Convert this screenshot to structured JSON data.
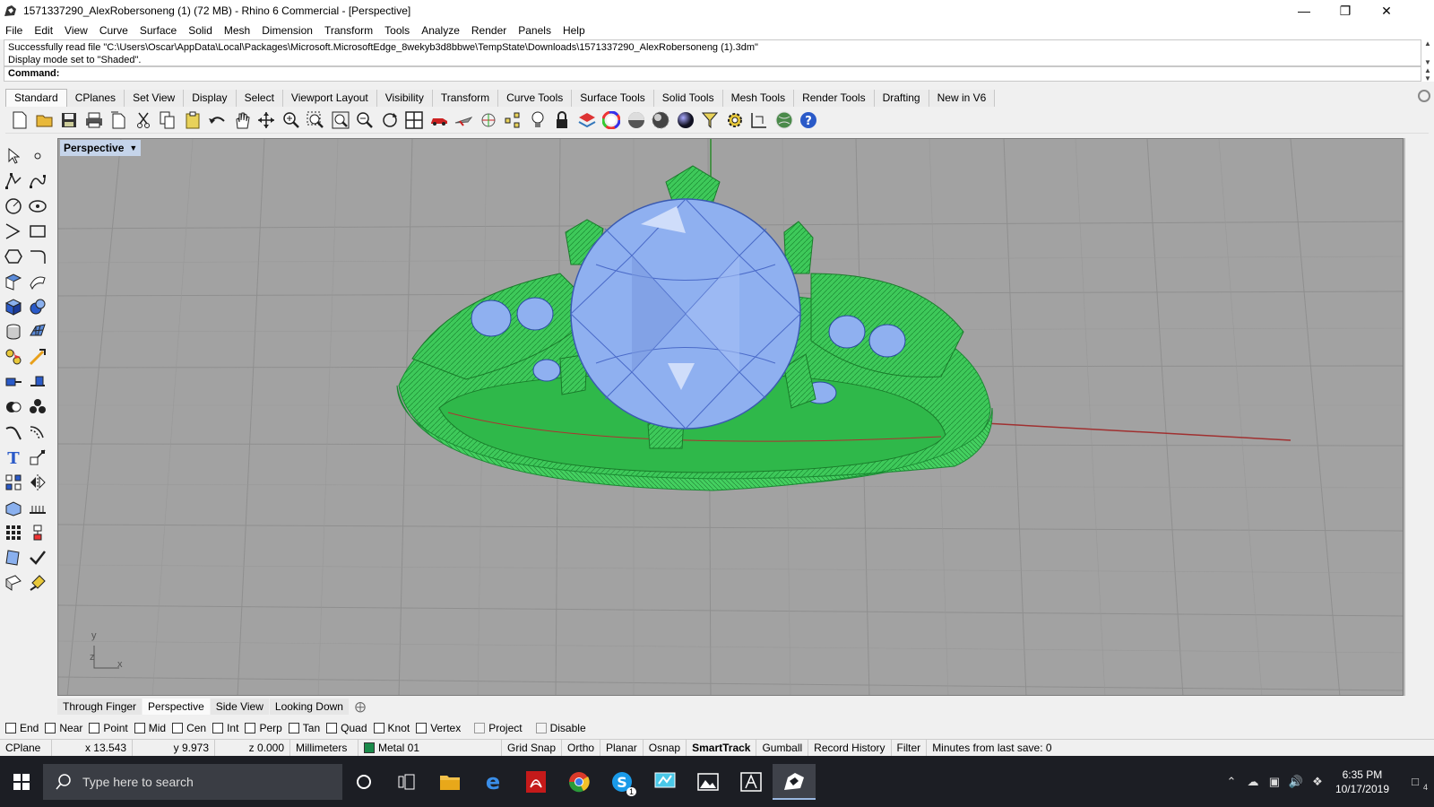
{
  "window": {
    "title": "1571337290_AlexRobersoneng (1) (72 MB) - Rhino 6 Commercial - [Perspective]",
    "minimize_icon": "minimize-icon",
    "maximize_icon": "restore-icon",
    "close_icon": "close-icon"
  },
  "menu": [
    "File",
    "Edit",
    "View",
    "Curve",
    "Surface",
    "Solid",
    "Mesh",
    "Dimension",
    "Transform",
    "Tools",
    "Analyze",
    "Render",
    "Panels",
    "Help"
  ],
  "command_history": {
    "line1": "Successfully read file \"C:\\Users\\Oscar\\AppData\\Local\\Packages\\Microsoft.MicrosoftEdge_8wekyb3d8bbwe\\TempState\\Downloads\\1571337290_AlexRobersoneng (1).3dm\"",
    "line2": "Display mode set to \"Shaded\"."
  },
  "command_prompt": "Command:",
  "toolbar_tabs": [
    "Standard",
    "CPlanes",
    "Set View",
    "Display",
    "Select",
    "Viewport Layout",
    "Visibility",
    "Transform",
    "Curve Tools",
    "Surface Tools",
    "Solid Tools",
    "Mesh Tools",
    "Render Tools",
    "Drafting",
    "New in V6"
  ],
  "active_tab": "Standard",
  "standard_tools": [
    "new-icon",
    "open-icon",
    "save-icon",
    "print-icon",
    "import-icon",
    "cut-icon",
    "copy-icon",
    "paste-icon",
    "undo-icon",
    "pan-icon",
    "rotate-view-icon",
    "zoom-dynamic-icon",
    "zoom-window-icon",
    "zoom-extents-icon",
    "zoom-selected-icon",
    "rotate-icon",
    "viewport-layout-icon",
    "car-icon",
    "flying-icon",
    "cplane-icon",
    "points-icon",
    "light-icon",
    "lock-icon",
    "layer-icon",
    "color-wheel-icon",
    "material-icon",
    "render-sphere-icon",
    "rendered-sphere-icon",
    "filter-icon",
    "settings-gear-icon",
    "dimension-icon",
    "plugin-globe-icon",
    "help-icon"
  ],
  "viewport": {
    "label": "Perspective",
    "axis_x": "x",
    "axis_y": "y",
    "axis_z": "z",
    "colors": {
      "background": "#a2a2a2",
      "grid": "#8e8e8e",
      "metal": "#3ec95a",
      "gem": "#8fb0f0",
      "x_axis": "#a03030",
      "y_axis": "#2a8a2a"
    }
  },
  "viewport_tabs": [
    "Through Finger",
    "Perspective",
    "Side View",
    "Looking Down"
  ],
  "active_viewport_tab": "Perspective",
  "osnaps": [
    {
      "label": "End",
      "checked": false
    },
    {
      "label": "Near",
      "checked": false
    },
    {
      "label": "Point",
      "checked": false
    },
    {
      "label": "Mid",
      "checked": false
    },
    {
      "label": "Cen",
      "checked": false
    },
    {
      "label": "Int",
      "checked": false
    },
    {
      "label": "Perp",
      "checked": false
    },
    {
      "label": "Tan",
      "checked": false
    },
    {
      "label": "Quad",
      "checked": false
    },
    {
      "label": "Knot",
      "checked": false
    },
    {
      "label": "Vertex",
      "checked": false
    },
    {
      "label": "Project",
      "checked": false
    },
    {
      "label": "Disable",
      "checked": false
    }
  ],
  "status": {
    "cplane": "CPlane",
    "x": "x 13.543",
    "y": "y 9.973",
    "z": "z 0.000",
    "units": "Millimeters",
    "layer": "Metal 01",
    "grid_snap": "Grid Snap",
    "ortho": "Ortho",
    "planar": "Planar",
    "osnap": "Osnap",
    "smarttrack": "SmartTrack",
    "gumball": "Gumball",
    "record_history": "Record History",
    "filter": "Filter",
    "last_save": "Minutes from last save: 0"
  },
  "taskbar": {
    "search_placeholder": "Type here to search",
    "apps": [
      "cortana-icon",
      "task-view-icon",
      "file-explorer-icon",
      "edge-icon",
      "acrobat-icon",
      "chrome-icon",
      "skype-icon",
      "monitor-app-icon",
      "photos-icon",
      "sketch-app-icon",
      "rhino-icon"
    ],
    "skype_badge": "1",
    "time": "6:35 PM",
    "date": "10/17/2019",
    "notifications": "4"
  }
}
